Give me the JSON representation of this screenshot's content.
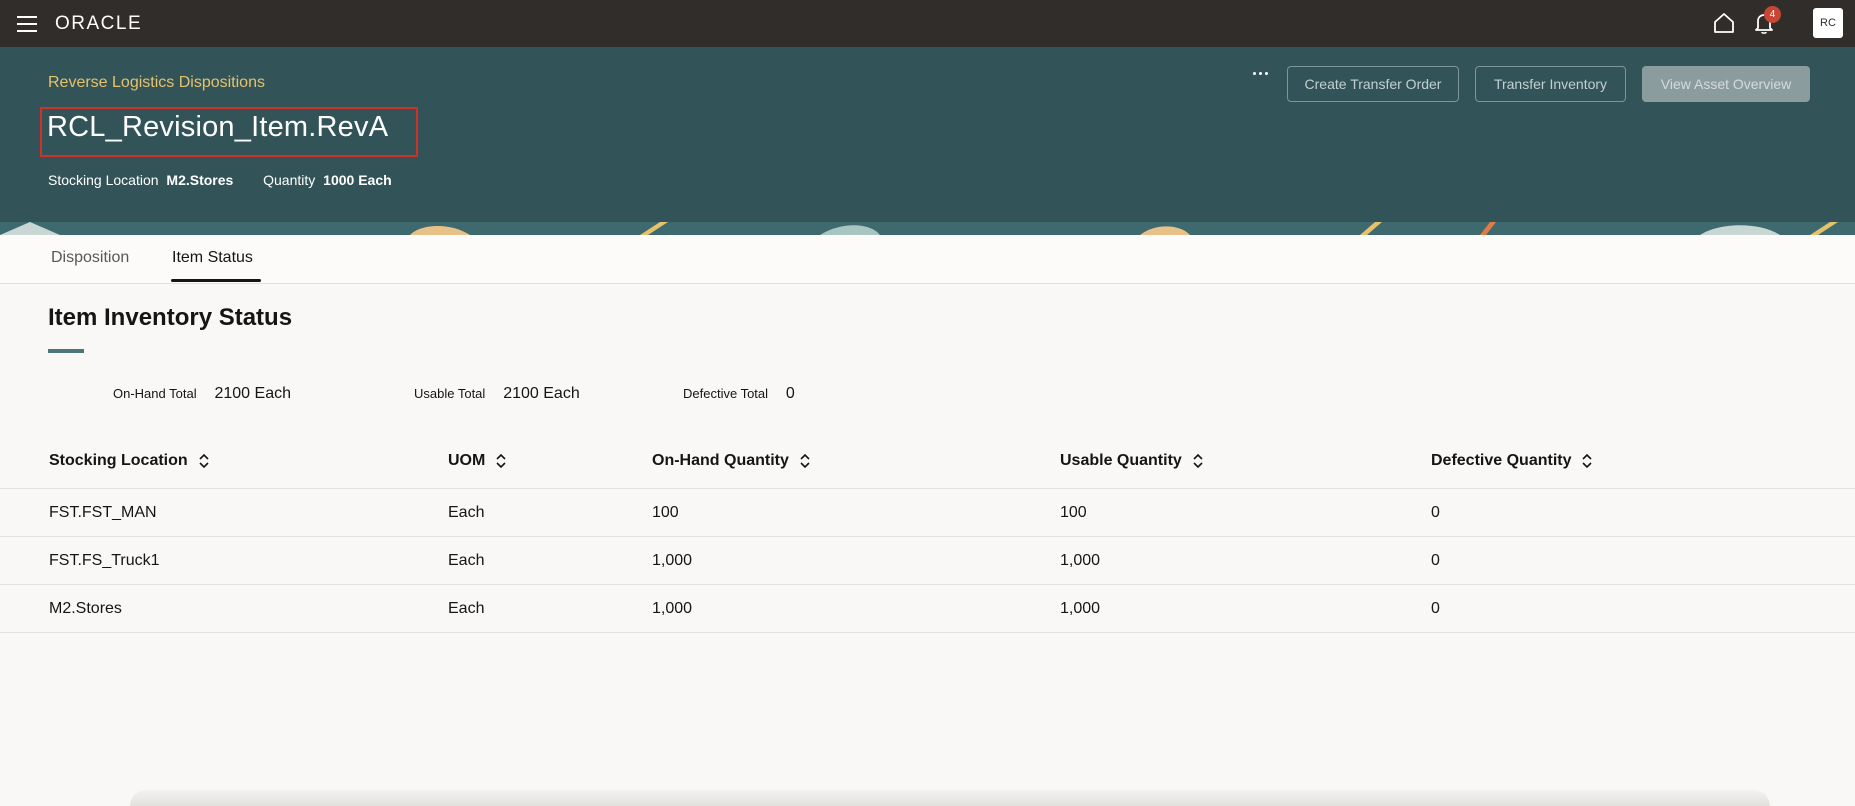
{
  "app": {
    "logo": "ORACLE",
    "notifications_count": "4",
    "user_initials": "RC"
  },
  "header": {
    "breadcrumb": "Reverse Logistics Dispositions",
    "title": "RCL_Revision_Item.RevA",
    "stocking_location_label": "Stocking Location",
    "stocking_location_value": "M2.Stores",
    "quantity_label": "Quantity",
    "quantity_value": "1000 Each",
    "buttons": {
      "create_transfer_order": "Create Transfer Order",
      "transfer_inventory": "Transfer Inventory",
      "view_asset_overview": "View Asset Overview"
    }
  },
  "tabs": [
    {
      "label": "Disposition",
      "selected": false
    },
    {
      "label": "Item Status",
      "selected": true
    }
  ],
  "section": {
    "title": "Item Inventory Status",
    "totals": {
      "on_hand_label": "On-Hand Total",
      "on_hand_value": "2100 Each",
      "usable_label": "Usable Total",
      "usable_value": "2100 Each",
      "defective_label": "Defective Total",
      "defective_value": "0"
    }
  },
  "table": {
    "columns": [
      "Stocking Location",
      "UOM",
      "On-Hand Quantity",
      "Usable Quantity",
      "Defective Quantity"
    ],
    "rows": [
      [
        "FST.FST_MAN",
        "Each",
        "100",
        "100",
        "0"
      ],
      [
        "FST.FS_Truck1",
        "Each",
        "1,000",
        "1,000",
        "0"
      ],
      [
        "M2.Stores",
        "Each",
        "1,000",
        "1,000",
        "0"
      ]
    ]
  },
  "colors": {
    "topbar": "#312d2a",
    "banner": "#325459",
    "breadcrumb": "#e5c26b",
    "highlight_box": "#d22f27",
    "badge": "#c74634"
  }
}
